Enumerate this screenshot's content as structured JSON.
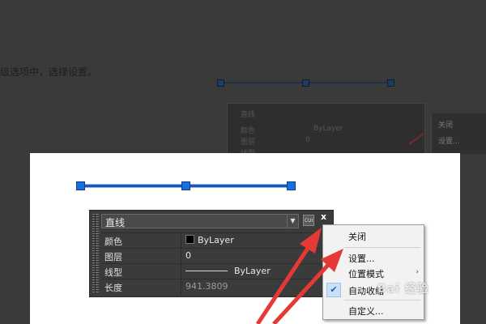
{
  "background": {
    "instruction_text": "级选项中，选择设置。",
    "panel_title": "直线",
    "panel_rows": [
      "颜色",
      "图层",
      "线型"
    ],
    "panel_values": [
      "ByLayer",
      "0"
    ],
    "menu_items": [
      "关闭",
      "设置..."
    ]
  },
  "properties_panel": {
    "object_type": "直线",
    "quick_select_label": "CUI",
    "close_label": "x",
    "rows": [
      {
        "label": "颜色",
        "value": "ByLayer",
        "kind": "color"
      },
      {
        "label": "图层",
        "value": "0",
        "kind": "text"
      },
      {
        "label": "线型",
        "value": "ByLayer",
        "kind": "linetype"
      },
      {
        "label": "长度",
        "value": "941.3809",
        "kind": "readonly"
      }
    ]
  },
  "context_menu": {
    "items": [
      {
        "label": "关闭"
      },
      {
        "label": "设置..."
      },
      {
        "label": "位置模式",
        "submenu": true
      },
      {
        "label": "自动收缩",
        "checked": true
      },
      {
        "label": "自定义..."
      }
    ]
  },
  "watermark": "Bai 经验",
  "colors": {
    "accent_arrow": "#e53935",
    "grip": "#1a6fe0",
    "panel_bg": "#3b3b3b",
    "menu_bg": "#f2f2f2"
  }
}
